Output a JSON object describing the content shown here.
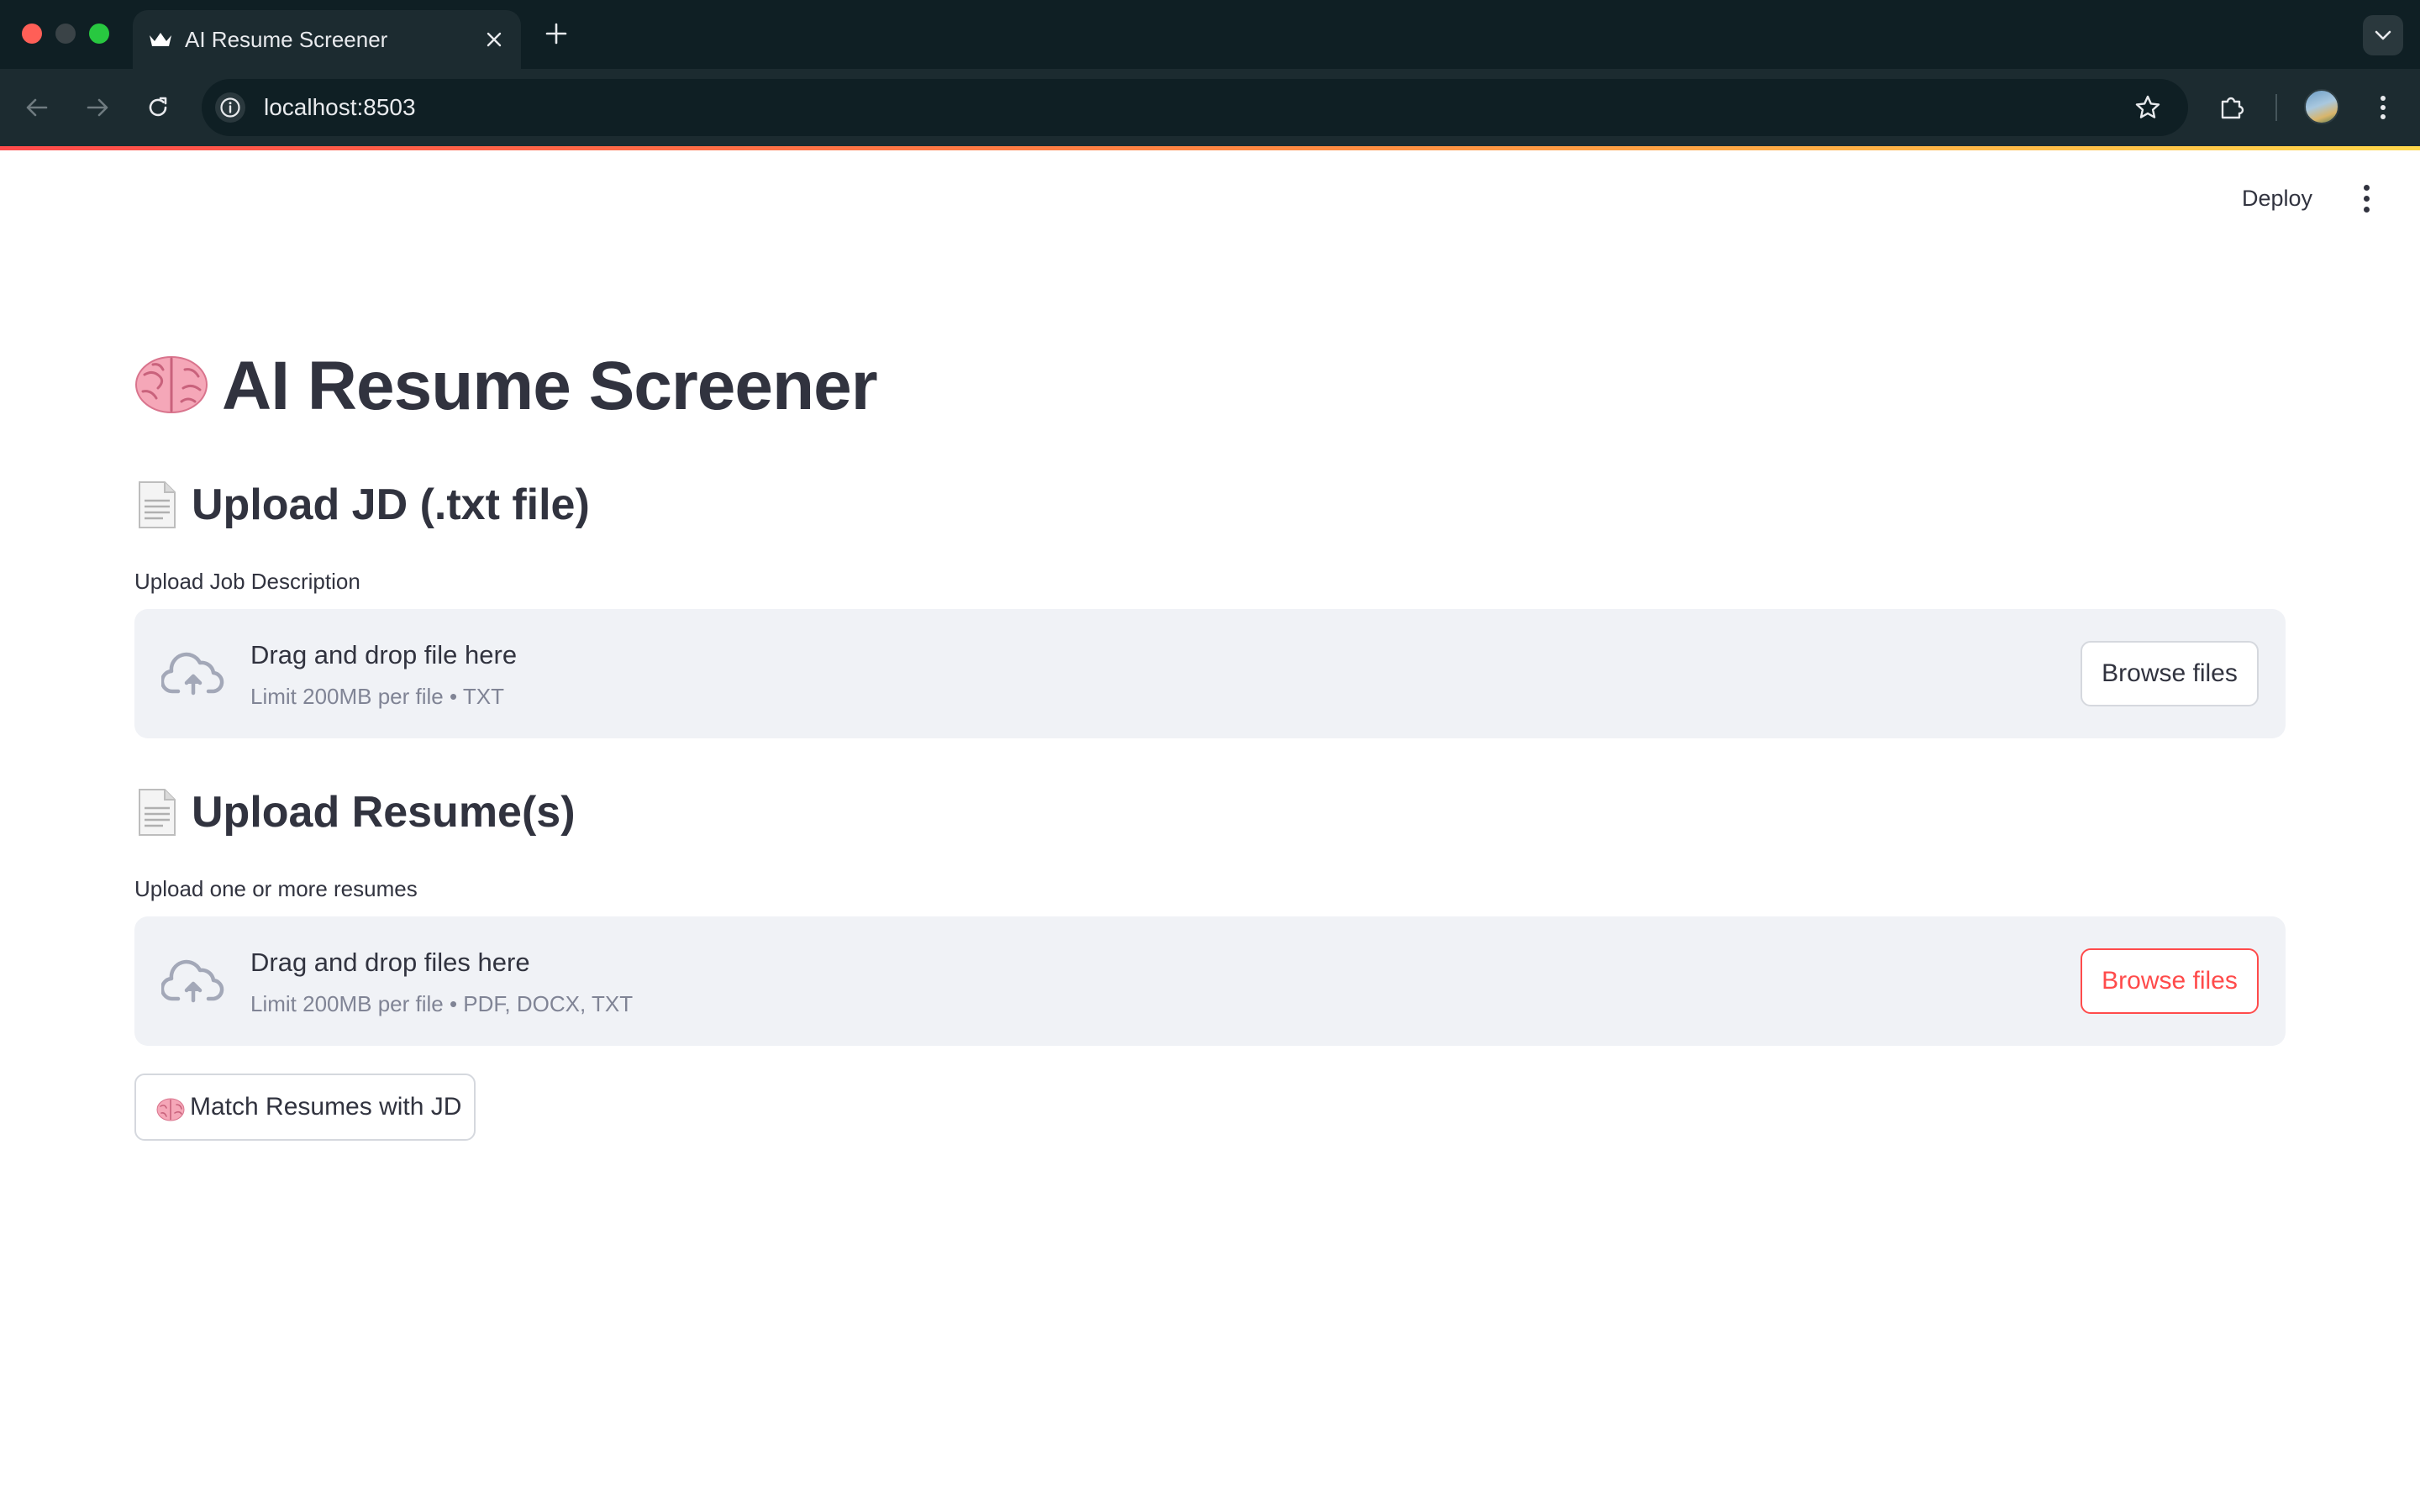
{
  "browser": {
    "tab_title": "AI Resume Screener",
    "url": "localhost:8503",
    "icons": {
      "favicon": "crown-icon",
      "tab_close": "close-icon",
      "new_tab": "plus-icon",
      "tab_search": "chevron-down-icon",
      "back": "arrow-left-icon",
      "forward": "arrow-right-icon",
      "reload": "reload-icon",
      "site_info": "info-icon",
      "bookmark": "star-icon",
      "extensions": "puzzle-icon",
      "profile": "avatar-icon",
      "menu": "kebab-menu-icon"
    }
  },
  "app": {
    "deploy_label": "Deploy",
    "menu_icon": "kebab-menu-icon",
    "title": "AI Resume Screener",
    "title_icon": "brain-emoji",
    "jd_section": {
      "heading": "Upload JD (.txt file)",
      "heading_icon": "document-emoji",
      "field_label": "Upload Job Description",
      "drop_text": "Drag and drop file here",
      "limit_text": "Limit 200MB per file • TXT",
      "upload_icon": "cloud-upload-icon",
      "browse_label": "Browse files"
    },
    "resume_section": {
      "heading": "Upload Resume(s)",
      "heading_icon": "document-emoji",
      "field_label": "Upload one or more resumes",
      "drop_text": "Drag and drop files here",
      "limit_text": "Limit 200MB per file • PDF, DOCX, TXT",
      "upload_icon": "cloud-upload-icon",
      "browse_label": "Browse files"
    },
    "match_button": {
      "label": "Match Resumes with JD",
      "icon": "brain-emoji"
    }
  },
  "colors": {
    "accent": "#ff4b4b",
    "text": "#31333f",
    "muted": "#808495",
    "dropzone_bg": "#f0f2f6",
    "chrome_dark": "#0f1f24",
    "chrome_toolbar": "#1c2b30"
  }
}
